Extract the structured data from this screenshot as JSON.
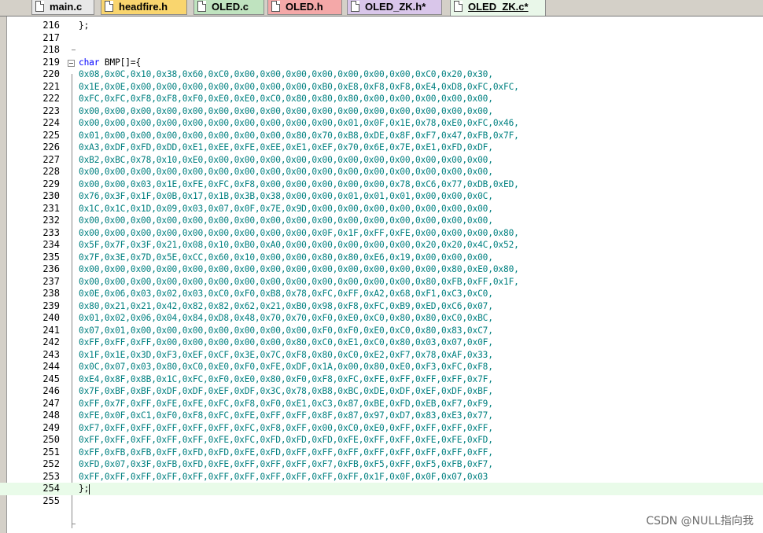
{
  "tabs": [
    {
      "label": "main.c",
      "color": "#e8e8e8",
      "active": false
    },
    {
      "label": "headfire.h",
      "color": "#f9d56e",
      "active": false
    },
    {
      "label": "OLED.c",
      "color": "#bfe3bf",
      "active": false
    },
    {
      "label": "OLED.h",
      "color": "#f4a8a8",
      "active": false
    },
    {
      "label": "OLED_ZK.h*",
      "color": "#d9c6ea",
      "active": false
    },
    {
      "label": "OLED_ZK.c*",
      "color": "#e9f7e9",
      "active": true
    }
  ],
  "editor": {
    "accent_colors": {
      "hex": "#008080",
      "keyword": "#0000ff",
      "current_line": "#e9fbe9"
    },
    "lines": [
      {
        "n": "216",
        "text": "};",
        "style": "plain"
      },
      {
        "n": "217",
        "text": "",
        "style": "plain"
      },
      {
        "n": "218",
        "text": "",
        "style": "plain"
      },
      {
        "n": "219",
        "kw": "char",
        "text": " BMP[]={",
        "style": "decl"
      },
      {
        "n": "220",
        "text": "0x08,0x0C,0x10,0x38,0x60,0xC0,0x00,0x00,0x00,0x00,0x00,0x00,0x00,0xC0,0x20,0x30,"
      },
      {
        "n": "221",
        "text": "0x1E,0x0E,0x00,0x00,0x00,0x00,0x00,0x00,0x00,0xB0,0xE8,0xF8,0xF8,0xE4,0xD8,0xFC,0xFC,"
      },
      {
        "n": "222",
        "text": "0xFC,0xFC,0xF8,0xF8,0xF0,0xE0,0xE0,0xC0,0x80,0x80,0x80,0x00,0x00,0x00,0x00,0x00,"
      },
      {
        "n": "223",
        "text": "0x00,0x00,0x00,0x00,0x00,0x00,0x00,0x00,0x00,0x00,0x00,0x00,0x00,0x00,0x00,0x00,"
      },
      {
        "n": "224",
        "text": "0x00,0x00,0x00,0x00,0x00,0x00,0x00,0x00,0x00,0x00,0x01,0x0F,0x1E,0x78,0xE0,0xFC,0x46,"
      },
      {
        "n": "225",
        "text": "0x01,0x00,0x00,0x00,0x00,0x00,0x00,0x00,0x80,0x70,0xB8,0xDE,0x8F,0xF7,0x47,0xFB,0x7F,"
      },
      {
        "n": "226",
        "text": "0xA3,0xDF,0xFD,0xDD,0xE1,0xEE,0xFE,0xEE,0xE1,0xEF,0x70,0x6E,0x7E,0xE1,0xFD,0xDF,"
      },
      {
        "n": "227",
        "text": "0xB2,0xBC,0x78,0x10,0xE0,0x00,0x00,0x00,0x00,0x00,0x00,0x00,0x00,0x00,0x00,0x00,"
      },
      {
        "n": "228",
        "text": "0x00,0x00,0x00,0x00,0x00,0x00,0x00,0x00,0x00,0x00,0x00,0x00,0x00,0x00,0x00,0x00,"
      },
      {
        "n": "229",
        "text": "0x00,0x00,0x03,0x1E,0xFE,0xFC,0xF8,0x00,0x00,0x00,0x00,0x00,0x78,0xC6,0x77,0xDB,0xED,"
      },
      {
        "n": "230",
        "text": "0x76,0x3F,0x1F,0x0B,0x17,0x1B,0x3B,0x38,0x00,0x00,0x01,0x01,0x01,0x00,0x00,0x0C,"
      },
      {
        "n": "231",
        "text": "0x1C,0x1C,0x1D,0x09,0x03,0x07,0x0F,0x7E,0x9D,0x00,0x00,0x00,0x00,0x00,0x00,0x00,"
      },
      {
        "n": "232",
        "text": "0x00,0x00,0x00,0x00,0x00,0x00,0x00,0x00,0x00,0x00,0x00,0x00,0x00,0x00,0x00,0x00,"
      },
      {
        "n": "233",
        "text": "0x00,0x00,0x00,0x00,0x00,0x00,0x00,0x00,0x00,0x0F,0x1F,0xFF,0xFE,0x00,0x00,0x00,0x80,"
      },
      {
        "n": "234",
        "text": "0x5F,0x7F,0x3F,0x21,0x08,0x10,0xB0,0xA0,0x00,0x00,0x00,0x00,0x00,0x20,0x20,0x4C,0x52,"
      },
      {
        "n": "235",
        "text": "0x7F,0x3E,0x7D,0x5E,0xCC,0x60,0x10,0x00,0x00,0x80,0x80,0xE6,0x19,0x00,0x00,0x00,"
      },
      {
        "n": "236",
        "text": "0x00,0x00,0x00,0x00,0x00,0x00,0x00,0x00,0x00,0x00,0x00,0x00,0x00,0x00,0x80,0xE0,0x80,"
      },
      {
        "n": "237",
        "text": "0x00,0x00,0x00,0x00,0x00,0x00,0x00,0x00,0x00,0x00,0x00,0x00,0x00,0x80,0xFB,0xFF,0x1F,"
      },
      {
        "n": "238",
        "text": "0x0E,0x06,0x03,0x02,0x03,0xC0,0xF0,0xB8,0x78,0xFC,0xFF,0xA2,0x68,0xF1,0xC3,0xC0,"
      },
      {
        "n": "239",
        "text": "0x80,0x21,0x21,0x42,0x82,0x82,0x62,0x21,0xB0,0x98,0xF8,0xFC,0xB9,0xED,0xC6,0x07,"
      },
      {
        "n": "240",
        "text": "0x01,0x02,0x06,0x04,0x84,0xD8,0x48,0x70,0x70,0xF0,0xE0,0xC0,0x80,0x80,0xC0,0xBC,"
      },
      {
        "n": "241",
        "text": "0x07,0x01,0x00,0x00,0x00,0x00,0x00,0x00,0x00,0xF0,0xF0,0xE0,0xC0,0x80,0x83,0xC7,"
      },
      {
        "n": "242",
        "text": "0xFF,0xFF,0xFF,0x00,0x00,0x00,0x00,0x00,0x80,0xC0,0xE1,0xC0,0x80,0x03,0x07,0x0F,"
      },
      {
        "n": "243",
        "text": "0x1F,0x1E,0x3D,0xF3,0xEF,0xCF,0x3E,0x7C,0xF8,0x80,0xC0,0xE2,0xF7,0x78,0xAF,0x33,"
      },
      {
        "n": "244",
        "text": "0x0C,0x07,0x03,0x80,0xC0,0xE0,0xF0,0xFE,0xDF,0x1A,0x00,0x80,0xE0,0xF3,0xFC,0xF8,"
      },
      {
        "n": "245",
        "text": "0xE4,0x8F,0x8B,0x1C,0xFC,0xF0,0xE0,0x80,0xF0,0xF8,0xFC,0xFE,0xFF,0xFF,0xFF,0x7F,"
      },
      {
        "n": "246",
        "text": "0x7F,0xBF,0xBF,0xDF,0xDF,0xEF,0xDF,0x3C,0x78,0xB8,0xBC,0xDE,0xDF,0xEF,0xDF,0xBF,"
      },
      {
        "n": "247",
        "text": "0xFF,0x7F,0xFF,0xFE,0xFE,0xFC,0xF8,0xF0,0xE1,0xC3,0x87,0xBE,0xFD,0xEB,0xF7,0xF9,"
      },
      {
        "n": "248",
        "text": "0xFE,0x0F,0xC1,0xF0,0xF8,0xFC,0xFE,0xFF,0xFF,0x8F,0x87,0x97,0xD7,0x83,0xE3,0x77,"
      },
      {
        "n": "249",
        "text": "0xF7,0xFF,0xFF,0xFF,0xFF,0xFF,0xFC,0xF8,0xFF,0x00,0xC0,0xE0,0xFF,0xFF,0xFF,0xFF,"
      },
      {
        "n": "250",
        "text": "0xFF,0xFF,0xFF,0xFF,0xFF,0xFE,0xFC,0xFD,0xFD,0xFD,0xFE,0xFF,0xFF,0xFE,0xFE,0xFD,"
      },
      {
        "n": "251",
        "text": "0xFF,0xFB,0xFB,0xFF,0xFD,0xFD,0xFE,0xFD,0xFF,0xFF,0xFF,0xFF,0xFF,0xFF,0xFF,0xFF,"
      },
      {
        "n": "252",
        "text": "0xFD,0x07,0x3F,0xFB,0xFD,0xFE,0xFF,0xFF,0xFF,0xF7,0xFB,0xF5,0xFF,0xF5,0xFB,0xF7,"
      },
      {
        "n": "253",
        "text": "0xFF,0xFF,0xFF,0xFF,0xFF,0xFF,0xFF,0xFF,0xFF,0xFF,0xFF,0x1F,0x0F,0x0F,0x07,0x03"
      },
      {
        "n": "254",
        "text": "};",
        "style": "plain",
        "current": true
      },
      {
        "n": "255",
        "text": "",
        "style": "plain"
      }
    ]
  },
  "watermark": "CSDN @NULL指向我"
}
